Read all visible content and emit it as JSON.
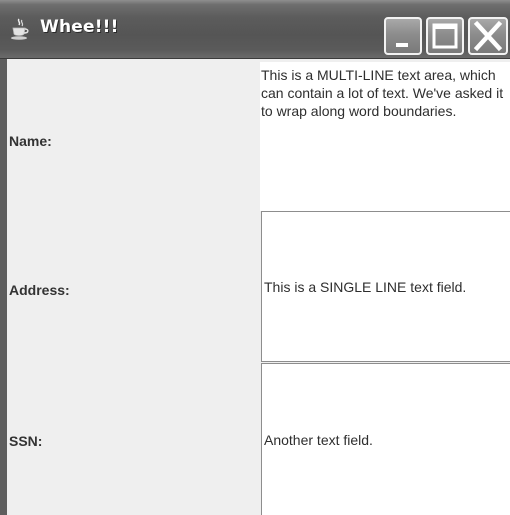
{
  "window": {
    "title": "Whee!!!",
    "icon": "java-cup-icon",
    "controls": [
      "minimize-icon",
      "maximize-icon",
      "close-icon"
    ]
  },
  "form": {
    "name_label": "Name:",
    "address_label": "Address:",
    "ssn_label": "SSN:",
    "name_value": "This is a MULTI-LINE text area, which can contain a lot of text. We've asked it to wrap along word boundaries.",
    "address_value": "This is a SINGLE LINE text field.",
    "ssn_value": "Another text field."
  }
}
